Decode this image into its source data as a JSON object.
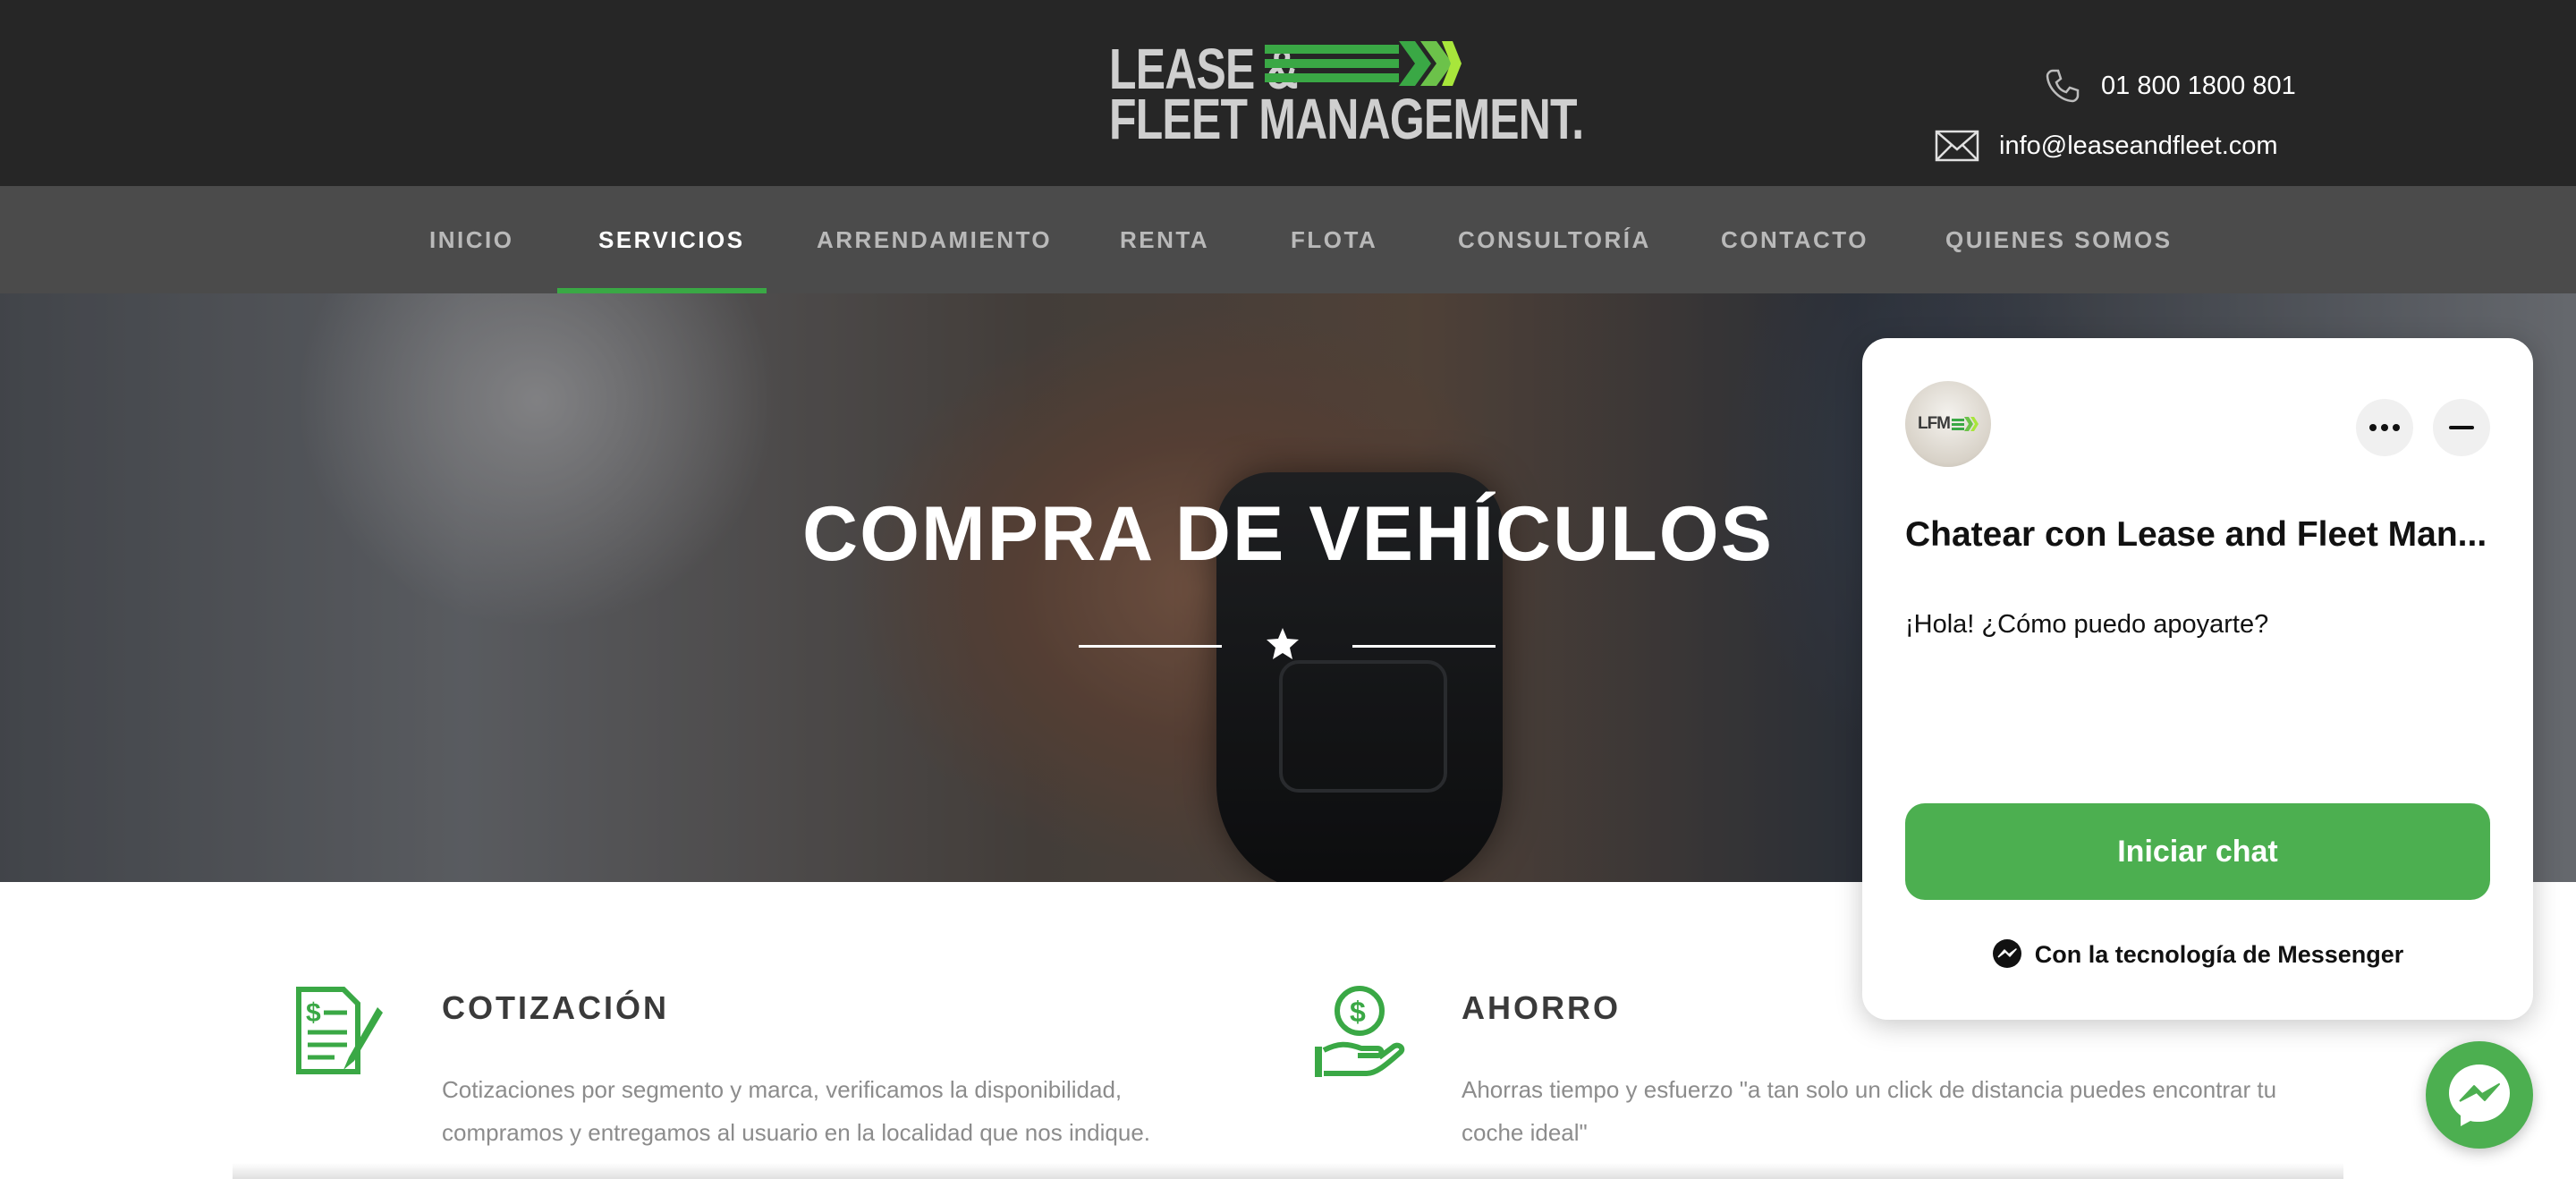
{
  "header": {
    "logo": {
      "line1": "LEASE &",
      "line2": "FLEET MANAGEMENT."
    },
    "phone": "01 800 1800 801",
    "email": "info@leaseandfleet.com"
  },
  "nav": {
    "items": [
      {
        "label": "INICIO",
        "active": false
      },
      {
        "label": "SERVICIOS",
        "active": true
      },
      {
        "label": "ARRENDAMIENTO",
        "active": false
      },
      {
        "label": "RENTA",
        "active": false
      },
      {
        "label": "FLOTA",
        "active": false
      },
      {
        "label": "CONSULTORÍA",
        "active": false
      },
      {
        "label": "CONTACTO",
        "active": false
      },
      {
        "label": "QUIENES SOMOS",
        "active": false
      }
    ]
  },
  "hero": {
    "title": "COMPRA DE VEHÍCULOS",
    "divider_icon": "star-icon"
  },
  "features": [
    {
      "icon": "quote-document-icon",
      "title": "COTIZACIÓN",
      "text": "Cotizaciones por segmento y marca, verificamos la disponibilidad, compramos y entregamos al usuario en la localidad que nos indique."
    },
    {
      "icon": "money-hand-icon",
      "title": "AHORRO",
      "text": "Ahorras tiempo y esfuerzo \"a tan solo un click de distancia puedes encontrar tu coche ideal\""
    }
  ],
  "chat": {
    "avatar_text": "LFM",
    "title": "Chatear con Lease and Fleet Man...",
    "greeting": "¡Hola! ¿Cómo puedo apoyarte?",
    "start_button": "Iniciar chat",
    "powered_by": "Con la tecnología de Messenger"
  },
  "colors": {
    "brand_green": "#3aa845",
    "chat_green": "#4caf50",
    "header_bg": "#262626"
  }
}
